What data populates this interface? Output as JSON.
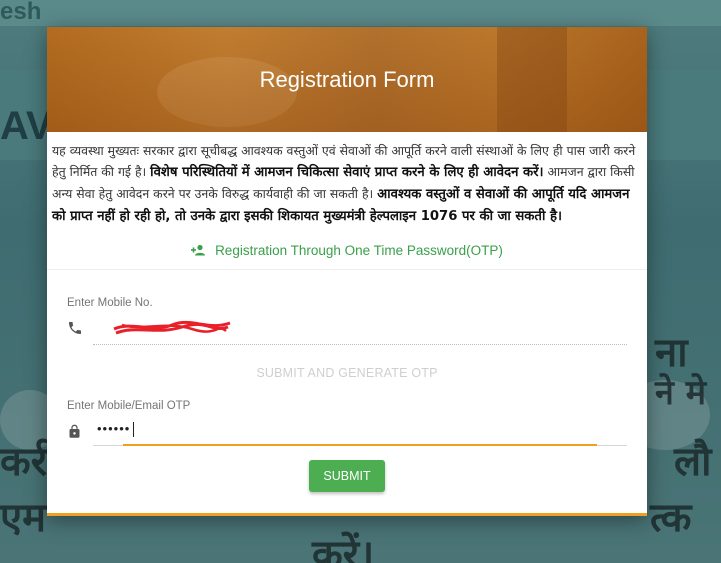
{
  "background": {
    "header_text": "esh",
    "side_text": "AV",
    "devanagari_fragments": [
      "ना",
      "ने मे",
      "लौ",
      "कर्र",
      "एम",
      "त्क",
      "करें।"
    ]
  },
  "modal": {
    "title": "Registration Form",
    "notice": {
      "part1": "यह व्यवस्था मुख्यतः सरकार द्वारा सूचीबद्ध आवश्यक वस्तुओं एवं सेवाओं की आपूर्ति करने वाली संस्थाओं के लिए ही पास जारी करने हेतु निर्मित की गई है। ",
      "part2_bold": "विशेष परिस्थितियों में आमजन चिकित्सा सेवाएं प्राप्त करने के लिए ही आवेदन करें।",
      "part3": " आमजन द्वारा किसी अन्य सेवा हेतु आवेदन करने पर उनके विरुद्ध कार्यवाही की जा सकती है। ",
      "part4_bold": "आवश्यक वस्तुओं व सेवाओं की आपूर्ति यदि आमजन को प्राप्त नहीं हो रही हो, तो उनके द्वारा इसकी शिकायत मुख्यमंत्री हेल्पलाइन 1076 पर की जा सकती है।"
    },
    "otp_link_label": "Registration Through One Time Password(OTP)",
    "mobile": {
      "label": "Enter Mobile No.",
      "value": ""
    },
    "generate_otp_label": "SUBMIT AND GENERATE OTP",
    "otp": {
      "label": "Enter Mobile/Email OTP",
      "value": "••••••"
    },
    "submit_label": "SUBMIT"
  },
  "colors": {
    "accent_green": "#4cae50",
    "link_green": "#3aa04a",
    "accent_orange": "#f0a020",
    "banner_brown": "#b26a1c"
  },
  "icons": {
    "otp_link": "person-add-icon",
    "mobile": "phone-icon",
    "otp": "lock-icon"
  }
}
